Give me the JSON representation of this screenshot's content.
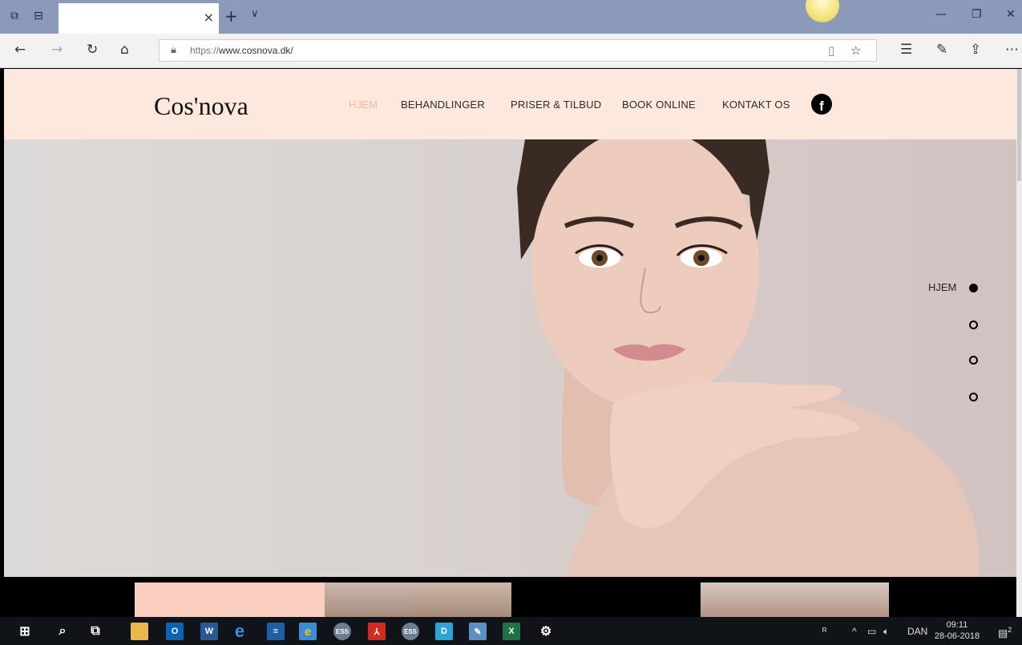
{
  "browser": {
    "tab_close": "×",
    "new_tab": "+",
    "tab_list": "∨",
    "url_scheme": "https://",
    "url_rest": "www.cosnova.dk/",
    "icons": [
      "tab-preview-icon",
      "set-aside-tabs-icon",
      "back-icon",
      "forward-icon",
      "refresh-icon",
      "home-icon",
      "lock-icon",
      "reading-view-icon",
      "favorite-star-icon",
      "favorites-list-icon",
      "pen-icon",
      "share-icon",
      "more-icon",
      "minimize-icon",
      "restore-icon",
      "close-icon"
    ]
  },
  "site": {
    "logo": "Cos'nova",
    "nav": [
      "HJEM",
      "BEHANDLINGER",
      "PRISER & TILBUD",
      "BOOK ONLINE",
      "KONTAKT OS"
    ],
    "facebook": "f",
    "section_dots_label": "HJEM",
    "colors": {
      "header_bg": "#fde8de",
      "active_nav": "#f2b9a0"
    }
  },
  "taskbar": {
    "language": "DAN",
    "time": "09:11",
    "date": "28-06-2018",
    "notifications": "2",
    "apps": [
      {
        "name": "start",
        "label": "⊞"
      },
      {
        "name": "search",
        "label": "⌕"
      },
      {
        "name": "task-view",
        "label": "⧉"
      },
      {
        "name": "file-explorer",
        "label": ""
      },
      {
        "name": "outlook",
        "label": "O"
      },
      {
        "name": "word",
        "label": "W"
      },
      {
        "name": "edge",
        "label": "e"
      },
      {
        "name": "app-blue",
        "label": "≡"
      },
      {
        "name": "internet-explorer",
        "label": "e"
      },
      {
        "name": "ess-1",
        "label": "ESS"
      },
      {
        "name": "acrobat",
        "label": "⅄"
      },
      {
        "name": "ess-2",
        "label": "ESS"
      },
      {
        "name": "app-photo",
        "label": "D"
      },
      {
        "name": "app-notes",
        "label": "✎"
      },
      {
        "name": "excel",
        "label": "X"
      },
      {
        "name": "settings",
        "label": "⚙"
      }
    ]
  }
}
